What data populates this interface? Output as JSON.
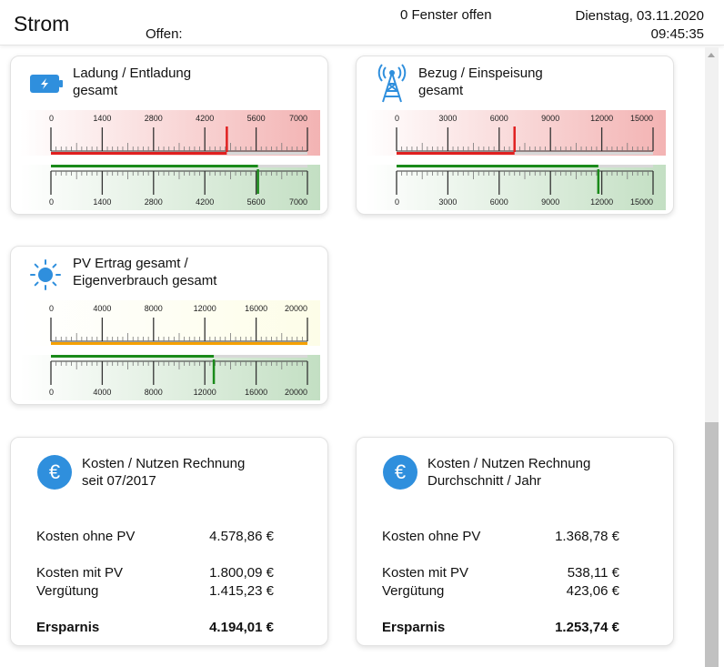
{
  "header": {
    "title": "Strom",
    "offen_label": "Offen:",
    "fenster": "0 Fenster offen",
    "date": "Dienstag, 03.11.2020",
    "time": "09:45:35"
  },
  "gauges": [
    {
      "title_line1": "Ladung / Entladung",
      "title_line2": "gesamt",
      "icon": "battery-icon",
      "max": 7000,
      "ticks": [
        "0",
        "1400",
        "2800",
        "4200",
        "5600",
        "7000"
      ],
      "top_value": 4800,
      "top_bar_value": 4800,
      "top_color": "#e02020",
      "top_bg": "#f3b3b3",
      "bottom_value": 5650,
      "bottom_bar_value": 5650,
      "bottom_color": "#1a8a1a",
      "bottom_bg": "#c3dfc3"
    },
    {
      "title_line1": "Bezug / Einspeisung",
      "title_line2": "gesamt",
      "icon": "antenna-tower-icon",
      "max": 15000,
      "ticks": [
        "0",
        "3000",
        "6000",
        "9000",
        "12000",
        "15000"
      ],
      "top_value": 6900,
      "top_bar_value": 6900,
      "top_color": "#e02020",
      "top_bg": "#f3b3b3",
      "bottom_value": 11800,
      "bottom_bar_value": 11800,
      "bottom_color": "#1a8a1a",
      "bottom_bg": "#c3dfc3"
    },
    {
      "title_line1": "PV Ertrag gesamt /",
      "title_line2": "Eigenverbrauch gesamt",
      "icon": "sun-icon",
      "max": 20000,
      "ticks": [
        "0",
        "4000",
        "8000",
        "12000",
        "16000",
        "20000"
      ],
      "top_value": 20000,
      "top_bar_value": 20000,
      "top_color": "#f5a000",
      "top_bg": "#fdfde8",
      "bottom_value": 12700,
      "bottom_bar_value": 12700,
      "bottom_color": "#1a8a1a",
      "bottom_bg": "#c3dfc3"
    }
  ],
  "cost_cards": [
    {
      "title_line1": "Kosten / Nutzen Rechnung",
      "title_line2": "seit 07/2017",
      "icon": "euro-icon",
      "euro_symbol": "€",
      "rows": [
        {
          "label": "Kosten ohne PV",
          "value": "4.578,86 €"
        },
        {
          "label": "Kosten mit PV",
          "value": "1.800,09 €"
        },
        {
          "label": "Vergütung",
          "value": "1.415,23 €"
        },
        {
          "label": "Ersparnis",
          "value": "4.194,01 €"
        }
      ]
    },
    {
      "title_line1": "Kosten / Nutzen Rechnung",
      "title_line2": "Durchschnitt / Jahr",
      "icon": "euro-icon",
      "euro_symbol": "€",
      "rows": [
        {
          "label": "Kosten ohne PV",
          "value": "1.368,78 €"
        },
        {
          "label": "Kosten mit PV",
          "value": "538,11 €"
        },
        {
          "label": "Vergütung",
          "value": "423,06 €"
        },
        {
          "label": "Ersparnis",
          "value": "1.253,74 €"
        }
      ]
    }
  ]
}
